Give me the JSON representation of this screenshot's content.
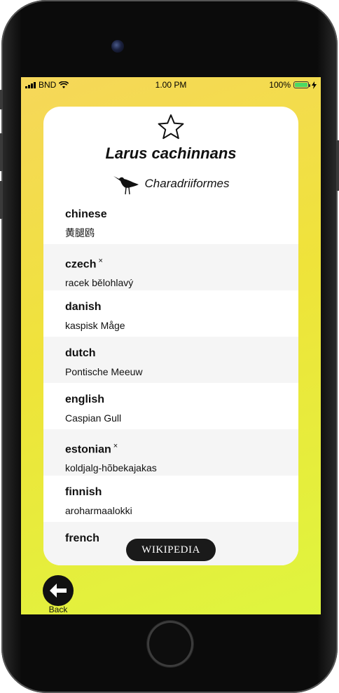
{
  "status_bar": {
    "carrier": "BND",
    "time": "1.00 PM",
    "battery": "100%",
    "battery_level": 1.0
  },
  "species": {
    "title": "Larus cachinnans",
    "order": "Charadriiformes",
    "favorite_icon": "star-outline-icon",
    "order_icon": "shorebird-silhouette-icon"
  },
  "names": [
    {
      "lang": "chinese",
      "mark": "",
      "value": "黄腿鸥"
    },
    {
      "lang": "czech",
      "mark": "×",
      "value": "racek bělohlavý"
    },
    {
      "lang": "danish",
      "mark": "",
      "value": "kaspisk Måge"
    },
    {
      "lang": "dutch",
      "mark": "",
      "value": "Pontische Meeuw"
    },
    {
      "lang": "english",
      "mark": "",
      "value": "Caspian Gull"
    },
    {
      "lang": "estonian",
      "mark": "×",
      "value": "koldjalg-hõbekajakas"
    },
    {
      "lang": "finnish",
      "mark": "",
      "value": "aroharmaalokki"
    },
    {
      "lang": "french",
      "mark": "",
      "value": ""
    }
  ],
  "wikipedia_button": "WIKIPEDIA",
  "back": {
    "label": "Back",
    "icon": "arrow-left-icon"
  },
  "colors": {
    "background_start": "#f6d75a",
    "background_end": "#dff53e",
    "battery": "#4cd964"
  }
}
